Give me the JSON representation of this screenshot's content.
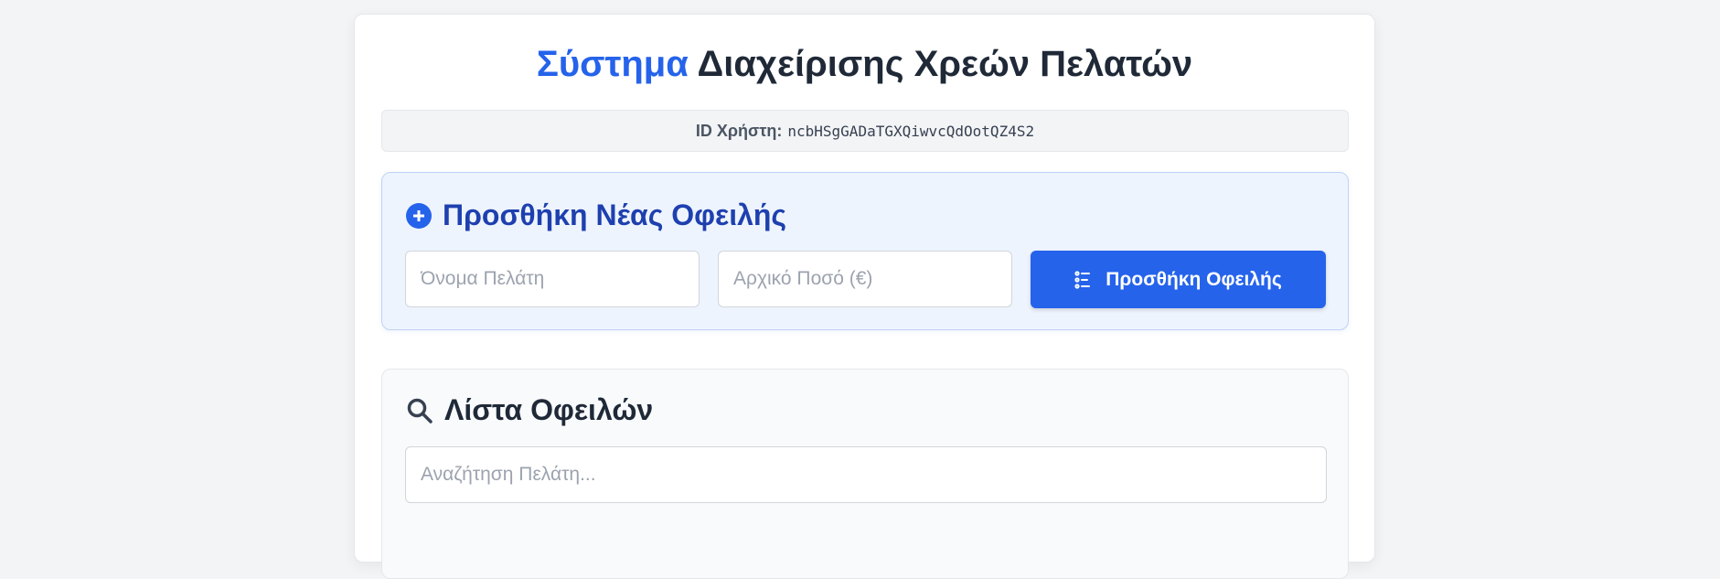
{
  "header": {
    "title_accent": "Σύστημα",
    "title_rest": " Διαχείρισης Χρεών Πελατών"
  },
  "user": {
    "label": "ID Χρήστη:",
    "id": "ncbHSgGADaTGXQiwvcQdOotQZ4S2"
  },
  "add_debt": {
    "title": "Προσθήκη Νέας Οφειλής",
    "name_placeholder": "Όνομα Πελάτη",
    "amount_placeholder": "Αρχικό Ποσό (€)",
    "submit_label": "Προσθήκη Οφειλής"
  },
  "debt_list": {
    "title": "Λίστα Οφειλών",
    "search_placeholder": "Αναζήτηση Πελάτη..."
  },
  "colors": {
    "accent": "#2563eb",
    "panel_bg": "#eef4fe"
  },
  "icons": {
    "add": "plus-circle-icon",
    "button": "list-add-icon",
    "search": "search-icon"
  }
}
